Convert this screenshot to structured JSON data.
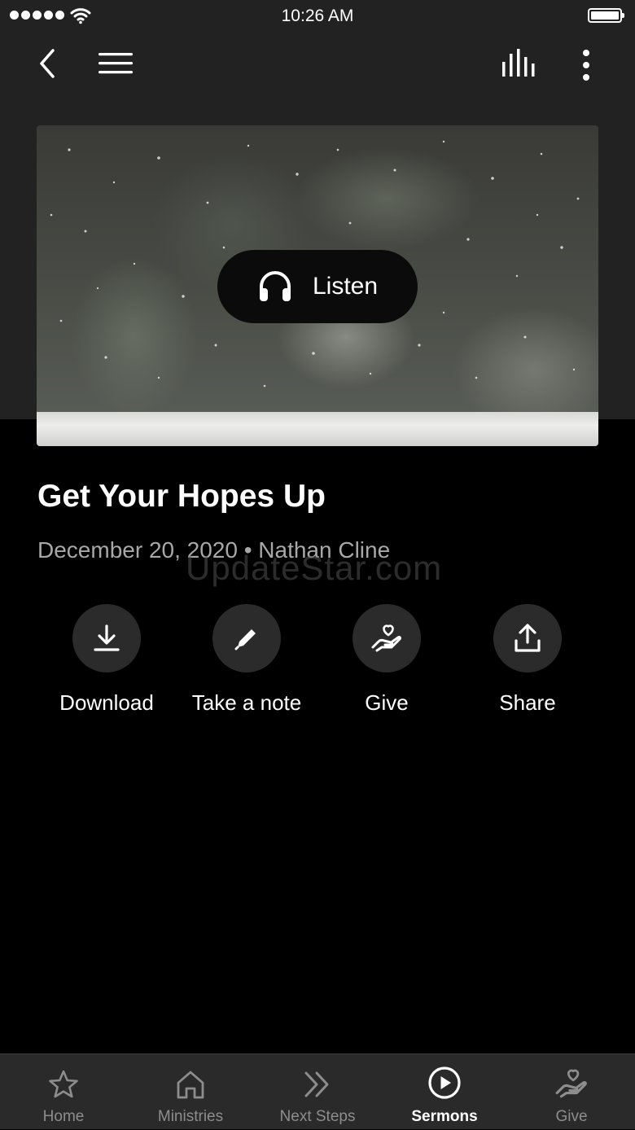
{
  "status_bar": {
    "time": "10:26 AM"
  },
  "header": {
    "back_icon": "chevron-left-icon",
    "menu_icon": "hamburger-menu-icon",
    "audio_icon": "audio-bars-icon",
    "more_icon": "more-vertical-icon"
  },
  "hero": {
    "listen_label": "Listen",
    "listen_icon": "headphones-icon"
  },
  "sermon": {
    "title": "Get Your Hopes Up",
    "meta": "December 20, 2020 • Nathan Cline"
  },
  "watermark": "UpdateStar.com",
  "actions": [
    {
      "label": "Download",
      "icon": "download-icon"
    },
    {
      "label": "Take a note",
      "icon": "pencil-icon"
    },
    {
      "label": "Give",
      "icon": "heart-hand-icon"
    },
    {
      "label": "Share",
      "icon": "share-icon"
    }
  ],
  "tabs": [
    {
      "label": "Home",
      "icon": "star-icon"
    },
    {
      "label": "Ministries",
      "icon": "house-icon"
    },
    {
      "label": "Next Steps",
      "icon": "double-chevron-icon"
    },
    {
      "label": "Sermons",
      "icon": "play-circle-icon",
      "active": true
    },
    {
      "label": "Give",
      "icon": "heart-hand-icon"
    }
  ],
  "colors": {
    "background": "#000000",
    "header_background": "#222222",
    "tab_bar": "#2a2a2a",
    "action_circle": "#2b2b2b",
    "meta_text": "#a8a8a8",
    "inactive_tab": "#8d8d8d"
  }
}
